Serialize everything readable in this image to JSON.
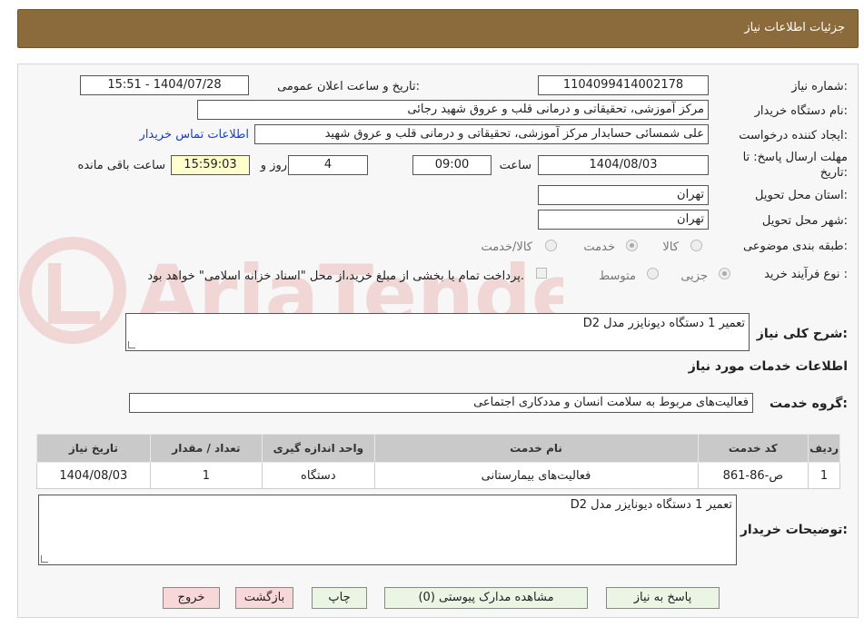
{
  "header": {
    "title": "جزئیات اطلاعات نیاز"
  },
  "form": {
    "need_number": {
      "label": "شماره نیاز:",
      "value": "1104099414002178"
    },
    "announce_datetime": {
      "label": "تاریخ و ساعت اعلان عمومی:",
      "value": "1404/07/28 - 15:51"
    },
    "buyer_org": {
      "label": "نام دستگاه خریدار:",
      "value": "مرکز آموزشی، تحقیقاتی و درمانی قلب و عروق شهید رجائی"
    },
    "requester": {
      "label": "ایجاد کننده درخواست:",
      "value": "علی شمسائی حسابدار مرکز آموزشی، تحقیقاتی و درمانی قلب و عروق شهید",
      "contact_link": "اطلاعات تماس خریدار"
    },
    "deadline": {
      "label_line1": "مهلت ارسال پاسخ: تا",
      "label_line2": "تاریخ:",
      "date": "1404/08/03",
      "time_label": "ساعت",
      "time": "09:00",
      "days": "4",
      "days_label": "روز و",
      "remaining": "15:59:03",
      "remaining_label": "ساعت باقی مانده"
    },
    "province": {
      "label": "استان محل تحویل:",
      "value": "تهران"
    },
    "city": {
      "label": "شهر محل تحویل:",
      "value": "تهران"
    },
    "category": {
      "label": "طبقه بندی موضوعی:",
      "options": [
        "کالا",
        "خدمت",
        "کالا/خدمت"
      ],
      "selected": "کالا"
    },
    "process": {
      "label": "نوع فرآیند خرید :",
      "options": [
        "جزیی",
        "متوسط"
      ],
      "selected": "جزیی",
      "payment_note": "پرداخت تمام یا بخشی از مبلغ خرید،از محل \"اسناد خزانه اسلامی\" خواهد بود."
    }
  },
  "summary": {
    "label": "شرح کلی نیاز:",
    "value": "تعمیر 1 دستگاه دیونایزر مدل D2"
  },
  "services_section": {
    "title": "اطلاعات خدمات مورد نیاز"
  },
  "service_group": {
    "label": "گروه خدمت:",
    "value": "فعالیت‌های مربوط به سلامت انسان و مددکاری اجتماعی"
  },
  "table": {
    "headers": [
      "ردیف",
      "کد خدمت",
      "نام خدمت",
      "واحد اندازه گیری",
      "تعداد / مقدار",
      "تاریخ نیاز"
    ],
    "rows": [
      [
        "1",
        "ص-86-861",
        "فعالیت‌های بیمارستانی",
        "دستگاه",
        "1",
        "1404/08/03"
      ]
    ]
  },
  "buyer_notes": {
    "label": "توضیحات خریدار:",
    "value": "تعمیر 1 دستگاه دیونایزر مدل D2"
  },
  "buttons": {
    "reply": "پاسخ به نیاز",
    "attachments": "مشاهده مدارک پیوستی (0)",
    "print": "چاپ",
    "back": "بازگشت",
    "exit": "خروج"
  },
  "watermark_text": "AriaTender.neT",
  "colors": {
    "title_bar": "#8b6a3c",
    "table_header": "#c9c9c9",
    "button_green": "#eaf5e4",
    "button_red": "#f7d7d7",
    "link": "#1a3fc4"
  }
}
